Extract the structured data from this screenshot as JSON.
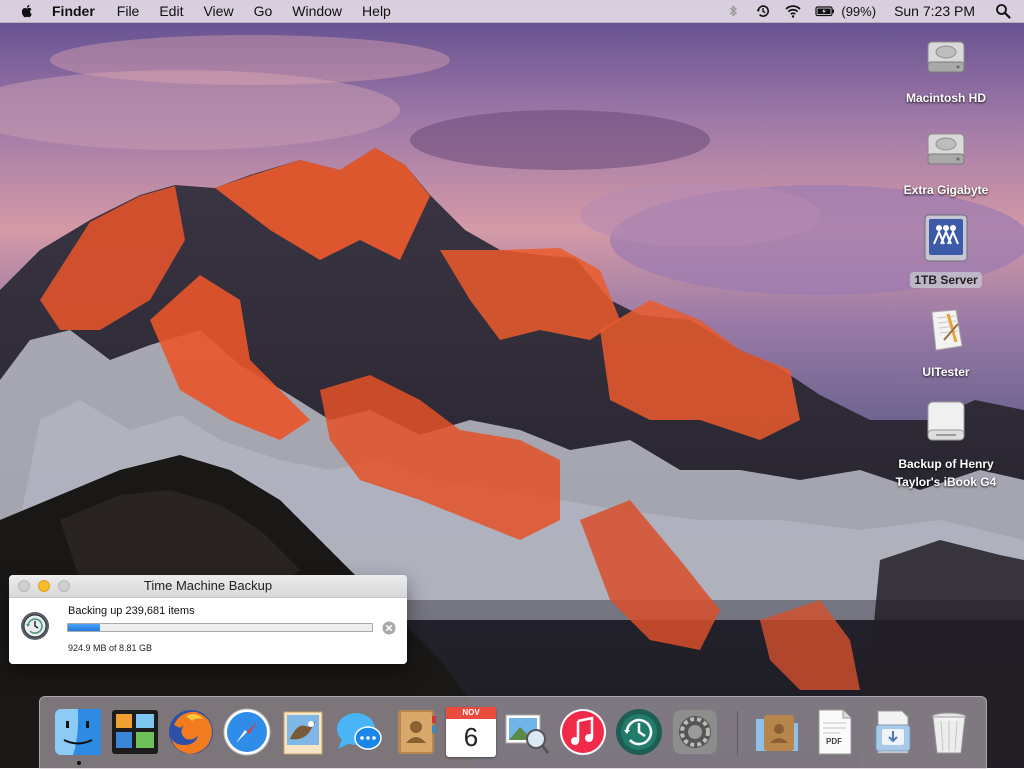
{
  "menubar": {
    "app_name": "Finder",
    "menus": [
      "File",
      "Edit",
      "View",
      "Go",
      "Window",
      "Help"
    ],
    "battery_text": "(99%)",
    "clock": "Sun 7:23 PM",
    "icons": [
      "apple-icon",
      "bluetooth-icon",
      "time-machine-menu-icon",
      "wifi-icon",
      "battery-icon",
      "spotlight-icon"
    ]
  },
  "desktop": {
    "icons": [
      {
        "label": "Macintosh HD",
        "icon": "hard-drive-icon",
        "selected": false
      },
      {
        "label": "Extra Gigabyte",
        "icon": "hard-drive-icon",
        "selected": false
      },
      {
        "label": "1TB Server",
        "icon": "network-server-icon",
        "selected": true
      },
      {
        "label": "UITester",
        "icon": "application-icon",
        "selected": false
      },
      {
        "label_line1": "Backup of Henry",
        "label_line2": "Taylor's iBook G4",
        "icon": "external-drive-icon",
        "selected": false
      }
    ]
  },
  "time_machine_window": {
    "title": "Time Machine Backup",
    "status": "Backing up 239,681 items",
    "detail": "924.9 MB of 8.81 GB",
    "progress": 0.105
  },
  "dock": {
    "items": [
      {
        "name": "Finder",
        "icon": "finder-icon",
        "running": true
      },
      {
        "name": "Mission Control",
        "icon": "mission-control-icon",
        "running": false
      },
      {
        "name": "Firefox",
        "icon": "firefox-icon",
        "running": false
      },
      {
        "name": "Safari",
        "icon": "safari-icon",
        "running": false
      },
      {
        "name": "Mail",
        "icon": "mail-icon",
        "running": false
      },
      {
        "name": "Messages",
        "icon": "messages-icon",
        "running": false
      },
      {
        "name": "Contacts",
        "icon": "contacts-icon",
        "running": false
      },
      {
        "name": "Calendar",
        "icon": "calendar-icon",
        "running": false,
        "month": "NOV",
        "day": "6"
      },
      {
        "name": "Preview",
        "icon": "preview-icon",
        "running": false
      },
      {
        "name": "iTunes",
        "icon": "itunes-icon",
        "running": false
      },
      {
        "name": "Time Machine",
        "icon": "time-machine-icon",
        "running": false
      },
      {
        "name": "System Preferences",
        "icon": "system-preferences-icon",
        "running": false
      },
      {
        "name": "Applications",
        "icon": "applications-folder-icon",
        "running": false
      },
      {
        "name": "Document",
        "icon": "pdf-document-icon",
        "running": false,
        "badge": "PDF"
      },
      {
        "name": "Downloads",
        "icon": "downloads-stack-icon",
        "running": false
      },
      {
        "name": "Trash",
        "icon": "trash-icon",
        "running": false
      }
    ]
  },
  "colors": {
    "progress_fill": "#1f78e3",
    "menubar_bg": "#ece4ec",
    "selection": "#c8c8d2"
  }
}
